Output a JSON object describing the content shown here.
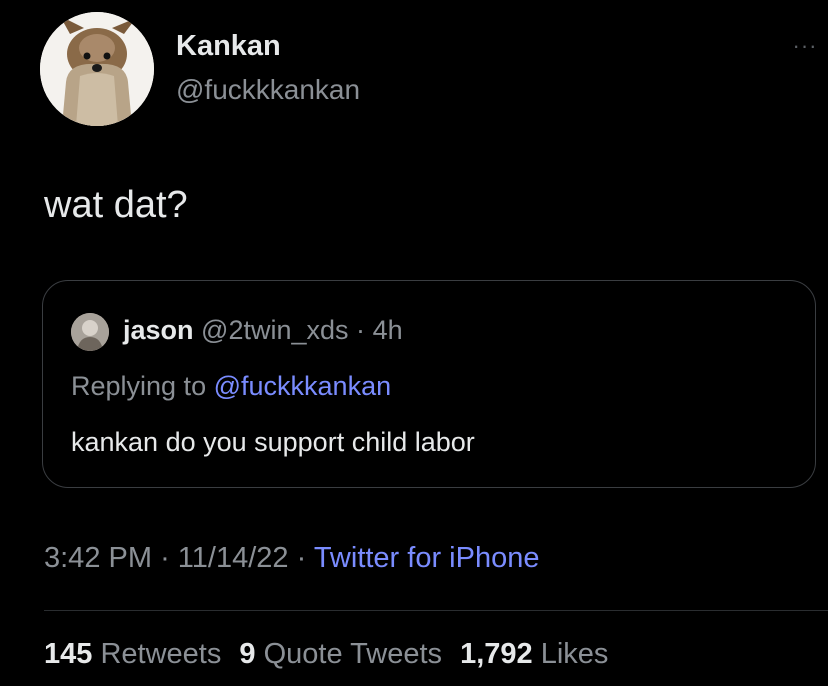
{
  "tweet": {
    "author": {
      "display_name": "Kankan",
      "handle": "@fuckkkankan",
      "avatar_icon": "dog-avatar"
    },
    "more_icon": "more-icon",
    "text": "wat dat?",
    "quoted": {
      "avatar_icon": "user-avatar",
      "name": "jason",
      "handle": "@2twin_xds",
      "separator": "·",
      "age": "4h",
      "replying_prefix": "Replying to",
      "replying_to": "@fuckkkankan",
      "text": "kankan do you support child labor"
    },
    "time": "3:42 PM",
    "sep1": "·",
    "date": "11/14/22",
    "sep2": "·",
    "source": "Twitter for iPhone",
    "stats": {
      "retweets_count": "145",
      "retweets_label": "Retweets",
      "quotes_count": "9",
      "quotes_label": "Quote Tweets",
      "likes_count": "1,792",
      "likes_label": "Likes"
    }
  },
  "colors": {
    "background": "#000000",
    "primary_text": "#e7e9ea",
    "secondary_text": "#8b9096",
    "link": "#7a8cff",
    "border": "#3a3d41"
  }
}
